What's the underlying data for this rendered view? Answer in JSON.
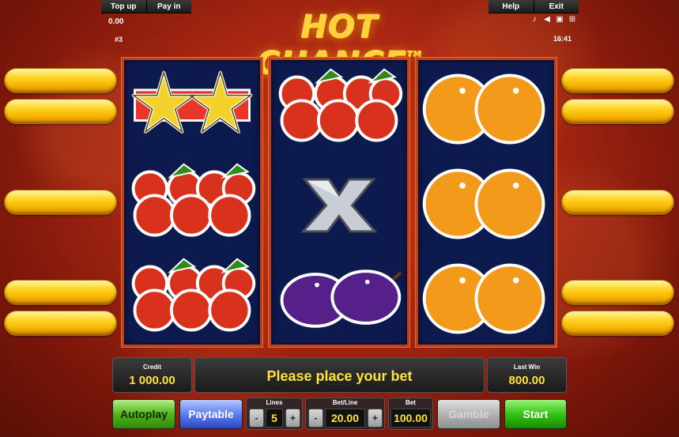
{
  "topbar": {
    "topup_label": "Top up",
    "payin_label": "Pay in",
    "help_label": "Help",
    "exit_label": "Exit",
    "credit_small": "0.00",
    "round": "#3",
    "time": "16:41",
    "icons": [
      "music-icon",
      "speaker-icon",
      "settings-icon",
      "fullscreen-icon"
    ]
  },
  "logo": {
    "text": "HOT CHANCE",
    "tm": "TM"
  },
  "reels": [
    [
      "double-star",
      "cherries",
      "cherries"
    ],
    [
      "cherries",
      "x-symbol",
      "plums"
    ],
    [
      "oranges",
      "oranges",
      "oranges"
    ]
  ],
  "panel": {
    "credit_label": "Credit",
    "credit_value": "1 000.00",
    "message": "Please place your bet",
    "lastwin_label": "Last Win",
    "lastwin_value": "800.00"
  },
  "controls": {
    "autoplay_label": "Autoplay",
    "paytable_label": "Paytable",
    "lines_label": "Lines",
    "lines_value": "5",
    "betline_label": "Bet/Line",
    "betline_value": "20.00",
    "bet_label": "Bet",
    "bet_value": "100.00",
    "gamble_label": "Gamble",
    "start_label": "Start",
    "minus": "-",
    "plus": "+"
  },
  "colors": {
    "accent_yellow": "#ffe23a",
    "reel_bg": "#0c1a4e",
    "frame": "#c24018"
  }
}
